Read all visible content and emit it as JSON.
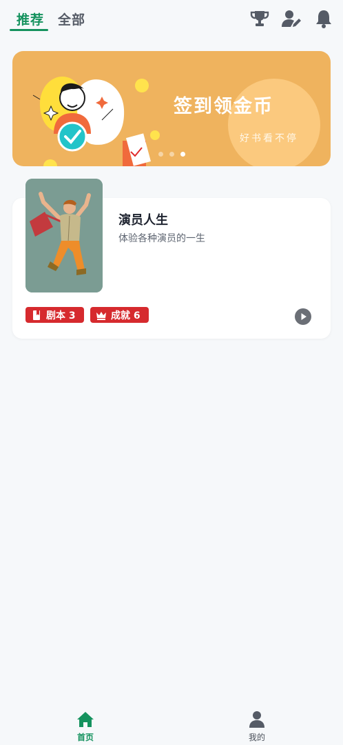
{
  "header": {
    "tabs": [
      {
        "label": "推荐",
        "active": true
      },
      {
        "label": "全部",
        "active": false
      }
    ],
    "icons": [
      "trophy-icon",
      "user-edit-icon",
      "bell-icon"
    ]
  },
  "banner": {
    "title": "签到领金币",
    "subtitle": "好书看不停",
    "slide_count": 3,
    "active_slide": 3
  },
  "story": {
    "title": "演员人生",
    "description": "体验各种演员的一生",
    "tags": [
      {
        "label": "剧本 3",
        "icon": "book-icon"
      },
      {
        "label": "成就 6",
        "icon": "crown-icon"
      }
    ],
    "action_icon": "play-icon"
  },
  "nav": {
    "items": [
      {
        "label": "首页",
        "icon": "home-icon",
        "active": true
      },
      {
        "label": "我的",
        "icon": "person-icon",
        "active": false
      }
    ]
  },
  "colors": {
    "accent": "#15925e",
    "banner": "#efb35e",
    "tag": "#d62a2e",
    "background": "#f6f8fa"
  }
}
